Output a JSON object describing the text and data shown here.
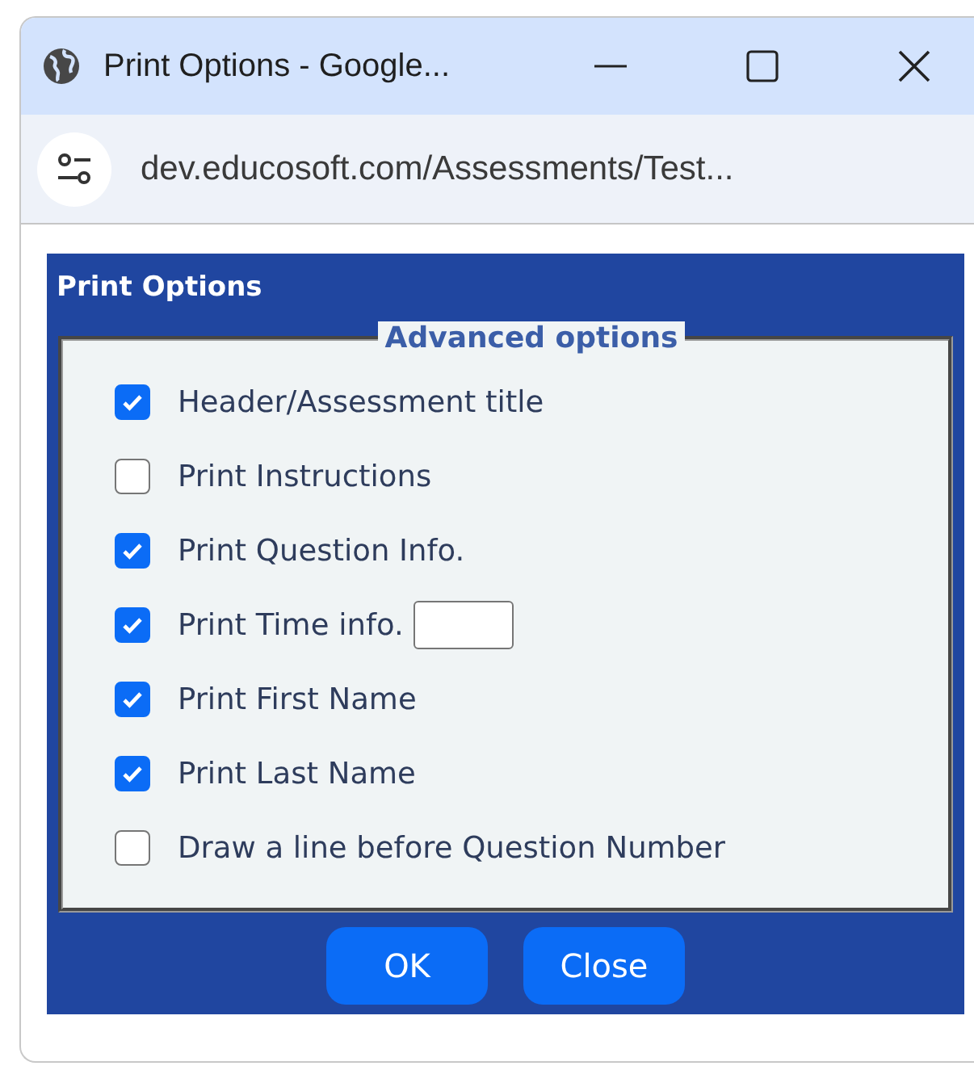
{
  "window": {
    "title": "Print Options - Google..."
  },
  "address_bar": {
    "url": "dev.educosoft.com/Assessments/Test..."
  },
  "dialog": {
    "title": "Print Options",
    "legend": "Advanced options",
    "options": [
      {
        "kind": "checkbox",
        "label": "Header/Assessment title",
        "checked": true
      },
      {
        "kind": "checkbox",
        "label": "Print Instructions",
        "checked": false
      },
      {
        "kind": "checkbox",
        "label": "Print Question Info.",
        "checked": true
      },
      {
        "kind": "checkbox_with_field",
        "label": "Print Time info.",
        "checked": true
      },
      {
        "kind": "checkbox",
        "label": "Print First Name",
        "checked": true
      },
      {
        "kind": "checkbox",
        "label": "Print Last Name",
        "checked": true
      },
      {
        "kind": "checkbox",
        "label": "Draw a line before Question Number",
        "checked": false
      }
    ],
    "buttons": [
      "OK",
      "Close"
    ]
  }
}
